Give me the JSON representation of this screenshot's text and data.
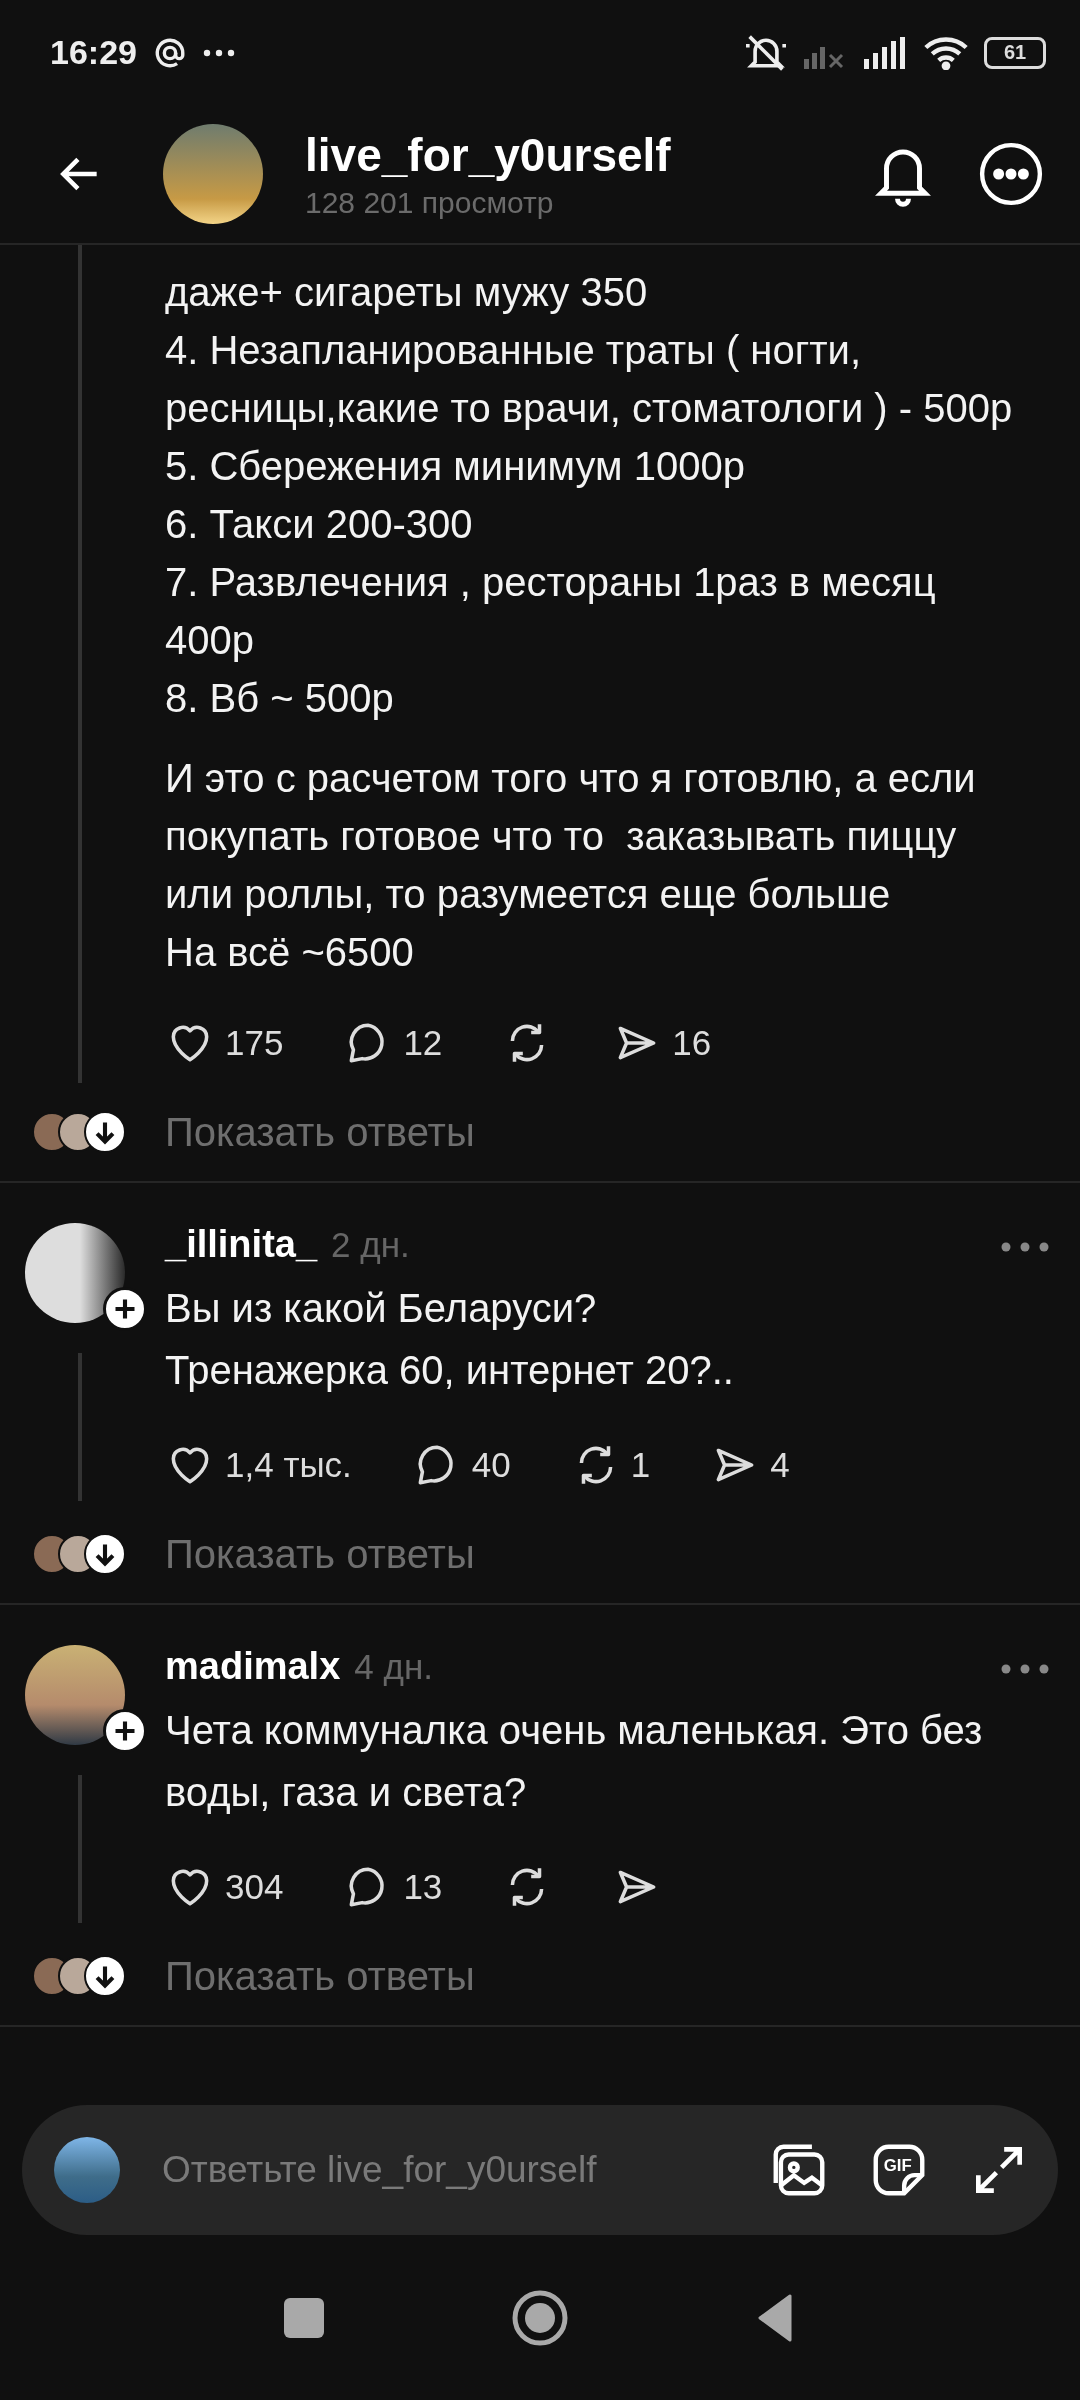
{
  "status_bar": {
    "time": "16:29",
    "battery": "61"
  },
  "header": {
    "title": "live_for_y0urself",
    "subtitle": "128 201 просмотр"
  },
  "post": {
    "paragraphs": [
      "даже+ сигареты мужу 350\n4. Незапланированные траты ( ногти,\nресницы,какие то врачи, стоматологи ) - 500р\n5. Сбережения минимум 1000р\n6. Такси 200-300\n7. Развлечения , рестораны 1раз в месяц\n400р\n8. Вб ~ 500р",
      "И это с расчетом того что я готовлю, а если\nпокупать готовое что то  заказывать пиццу\nили роллы, то разумеется еще больше\nНа всё ~6500"
    ],
    "actions": [
      {
        "kind": "like",
        "count": "175"
      },
      {
        "kind": "comment",
        "count": "12"
      },
      {
        "kind": "repost"
      },
      {
        "kind": "share",
        "count": "16"
      }
    ],
    "show_replies": "Показать ответы"
  },
  "comments": [
    {
      "username": "_illinita_",
      "time": "2 дн.",
      "text": "Вы из какой Беларуси?\nТренажерка 60, интернет 20?..",
      "actions": [
        {
          "kind": "like",
          "count": "1,4 тыс."
        },
        {
          "kind": "comment",
          "count": "40"
        },
        {
          "kind": "repost",
          "count": "1"
        },
        {
          "kind": "share",
          "count": "4"
        }
      ],
      "show_replies": "Показать ответы"
    },
    {
      "username": "madimalx",
      "time": "4 дн.",
      "text": "Чета коммуналка очень маленькая. Это без\nводы, газа и света?",
      "actions": [
        {
          "kind": "like",
          "count": "304"
        },
        {
          "kind": "comment",
          "count": "13"
        },
        {
          "kind": "repost"
        },
        {
          "kind": "share"
        }
      ],
      "show_replies": "Показать ответы"
    }
  ],
  "reply_bar": {
    "placeholder": "Ответьте live_for_y0urself",
    "gif_label": "GIF"
  }
}
